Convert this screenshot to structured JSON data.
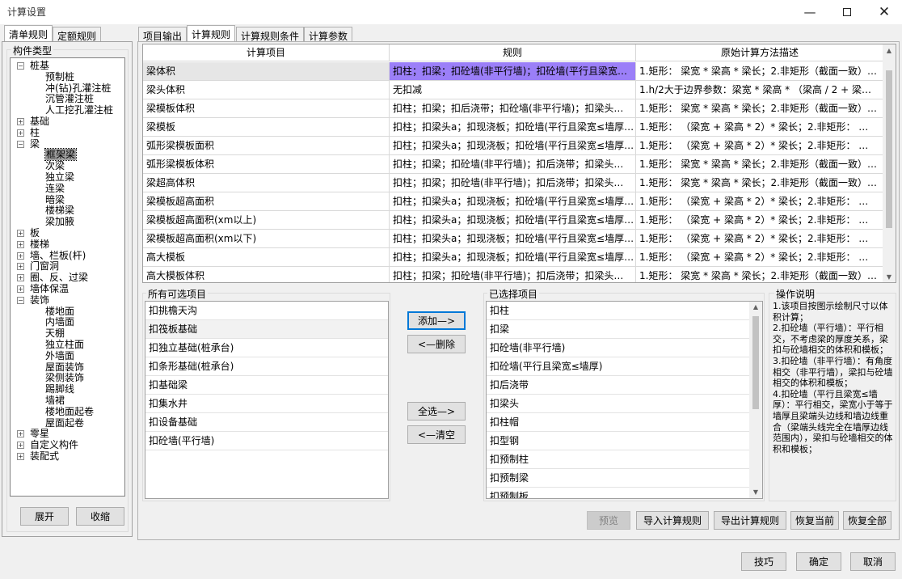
{
  "window": {
    "title": "计算设置"
  },
  "left_tabs": [
    "清单规则",
    "定额规则"
  ],
  "component_type_label": "构件类型",
  "tree": [
    {
      "label": "桩基",
      "level": 0,
      "expanded": true
    },
    {
      "label": "预制桩",
      "level": 1
    },
    {
      "label": "冲(钻)孔灌注桩",
      "level": 1
    },
    {
      "label": "沉管灌注桩",
      "level": 1
    },
    {
      "label": "人工挖孔灌注桩",
      "level": 1
    },
    {
      "label": "基础",
      "level": 0,
      "expanded": false
    },
    {
      "label": "柱",
      "level": 0,
      "expanded": false
    },
    {
      "label": "梁",
      "level": 0,
      "expanded": true
    },
    {
      "label": "框架梁",
      "level": 1,
      "selected": true
    },
    {
      "label": "次梁",
      "level": 1
    },
    {
      "label": "独立梁",
      "level": 1
    },
    {
      "label": "连梁",
      "level": 1
    },
    {
      "label": "暗梁",
      "level": 1
    },
    {
      "label": "楼梯梁",
      "level": 1
    },
    {
      "label": "梁加腋",
      "level": 1
    },
    {
      "label": "板",
      "level": 0,
      "expanded": false
    },
    {
      "label": "楼梯",
      "level": 0,
      "expanded": false
    },
    {
      "label": "墙、栏板(杆)",
      "level": 0,
      "expanded": false
    },
    {
      "label": "门窗洞",
      "level": 0,
      "expanded": false
    },
    {
      "label": "圈、反、过梁",
      "level": 0,
      "expanded": false
    },
    {
      "label": "墙体保温",
      "level": 0,
      "expanded": false
    },
    {
      "label": "装饰",
      "level": 0,
      "expanded": true
    },
    {
      "label": "楼地面",
      "level": 1
    },
    {
      "label": "内墙面",
      "level": 1
    },
    {
      "label": "天棚",
      "level": 1
    },
    {
      "label": "独立柱面",
      "level": 1
    },
    {
      "label": "外墙面",
      "level": 1
    },
    {
      "label": "屋面装饰",
      "level": 1
    },
    {
      "label": "梁侧装饰",
      "level": 1
    },
    {
      "label": "踢脚线",
      "level": 1
    },
    {
      "label": "墙裙",
      "level": 1
    },
    {
      "label": "楼地面起卷",
      "level": 1
    },
    {
      "label": "屋面起卷",
      "level": 1
    },
    {
      "label": "零星",
      "level": 0,
      "expanded": false
    },
    {
      "label": "自定义构件",
      "level": 0,
      "expanded": false
    },
    {
      "label": "装配式",
      "level": 0,
      "expanded": false
    }
  ],
  "left_buttons": {
    "expand": "展开",
    "collapse": "收缩"
  },
  "right_tabs": [
    "项目输出",
    "计算规则",
    "计算规则条件",
    "计算参数"
  ],
  "grid": {
    "headers": [
      "计算项目",
      "规则",
      "原始计算方法描述"
    ],
    "rows": [
      [
        "梁体积",
        "扣柱；扣梁；扣砼墙(非平行墙)；扣砼墙(平行且梁宽…",
        "1.矩形：  梁宽 * 梁高 * 梁长；2.非矩形（截面一致）…"
      ],
      [
        "梁头体积",
        "无扣减",
        "1.h/2大于边界参数：梁宽 * 梁高 * （梁高 / 2 + 梁…"
      ],
      [
        "梁模板体积",
        "扣柱；扣梁；扣后浇带；扣砼墙(非平行墙)；扣梁头…",
        "1.矩形：  梁宽 * 梁高 * 梁长；2.非矩形（截面一致）…"
      ],
      [
        "梁模板",
        "扣柱；扣梁头a；扣现浇板；扣砼墙(平行且梁宽≤墙厚…",
        "1.矩形：   （梁宽 + 梁高 * 2）* 梁长；2.非矩形：  …"
      ],
      [
        "弧形梁模板面积",
        "扣柱；扣梁头a；扣现浇板；扣砼墙(平行且梁宽≤墙厚…",
        "1.矩形：   （梁宽 + 梁高 * 2）* 梁长；2.非矩形：  …"
      ],
      [
        "弧形梁模板体积",
        "扣柱；扣梁；扣砼墙(非平行墙)；扣后浇带；扣梁头…",
        "1.矩形：  梁宽 * 梁高 * 梁长；2.非矩形（截面一致）…"
      ],
      [
        "梁超高体积",
        "扣柱；扣梁；扣砼墙(非平行墙)；扣后浇带；扣梁头…",
        "1.矩形：  梁宽 * 梁高 * 梁长；2.非矩形（截面一致）…"
      ],
      [
        "梁模板超高面积",
        "扣柱；扣梁头a；扣现浇板；扣砼墙(平行且梁宽≤墙厚…",
        "1.矩形：   （梁宽 + 梁高 * 2）* 梁长；2.非矩形：  …"
      ],
      [
        "梁模板超高面积(xm以上)",
        "扣柱；扣梁头a；扣现浇板；扣砼墙(平行且梁宽≤墙厚…",
        "1.矩形：   （梁宽 + 梁高 * 2）* 梁长；2.非矩形：  …"
      ],
      [
        "梁模板超高面积(xm以下)",
        "扣柱；扣梁头a；扣现浇板；扣砼墙(平行且梁宽≤墙厚…",
        "1.矩形：   （梁宽 + 梁高 * 2）* 梁长；2.非矩形：  …"
      ],
      [
        "高大模板",
        "扣柱；扣梁头a；扣现浇板；扣砼墙(平行且梁宽≤墙厚…",
        "1.矩形：   （梁宽 + 梁高 * 2）* 梁长；2.非矩形：  …"
      ],
      [
        "高大模板体积",
        "扣柱；扣梁；扣砼墙(非平行墙)；扣后浇带；扣梁头…",
        "1.矩形：  梁宽 * 梁高 * 梁长；2.非矩形（截面一致）…"
      ]
    ]
  },
  "available": {
    "label": "所有可选项目",
    "items": [
      "扣挑檐天沟",
      "扣筏板基础",
      "扣独立基础(桩承台)",
      "扣条形基础(桩承台)",
      "扣基础梁",
      "扣集水井",
      "扣设备基础",
      "扣砼墙(平行墙)"
    ]
  },
  "selected": {
    "label": "已选择项目",
    "items": [
      "扣柱",
      "扣梁",
      "扣砼墙(非平行墙)",
      "扣砼墙(平行且梁宽≤墙厚)",
      "扣后浇带",
      "扣梁头",
      "扣柱帽",
      "扣型钢",
      "扣预制柱",
      "扣预制梁",
      "扣预制板"
    ]
  },
  "mid_buttons": {
    "add": "添加—>",
    "delete": "<—删除",
    "select_all": "全选—>",
    "clear": "<—清空"
  },
  "instructions": {
    "label": "操作说明",
    "text": "1.该项目按图示绘制尺寸以体积计算；\n2.扣砼墙（平行墙）：平行相交，不考虑梁的厚度关系，梁扣与砼墙相交的体积和模板；\n3.扣砼墙（非平行墙）：有角度相交（非平行墙），梁扣与砼墙相交的体积和模板；\n4.扣砼墙（平行且梁宽≤墙厚）：平行相交，梁宽小于等于墙厚且梁端头边线和墙边线重合（梁端头线完全在墙厚边线范围内），梁扣与砼墙相交的体积和模板；"
  },
  "action_buttons": {
    "preview": "预览",
    "import": "导入计算规则",
    "export": "导出计算规则",
    "restore_current": "恢复当前",
    "restore_all": "恢复全部"
  },
  "footer_buttons": {
    "tips": "技巧",
    "ok": "确定",
    "cancel": "取消"
  },
  "colors": {
    "highlight": "#9b7ff8",
    "selected_row": "#e6e6e6"
  }
}
